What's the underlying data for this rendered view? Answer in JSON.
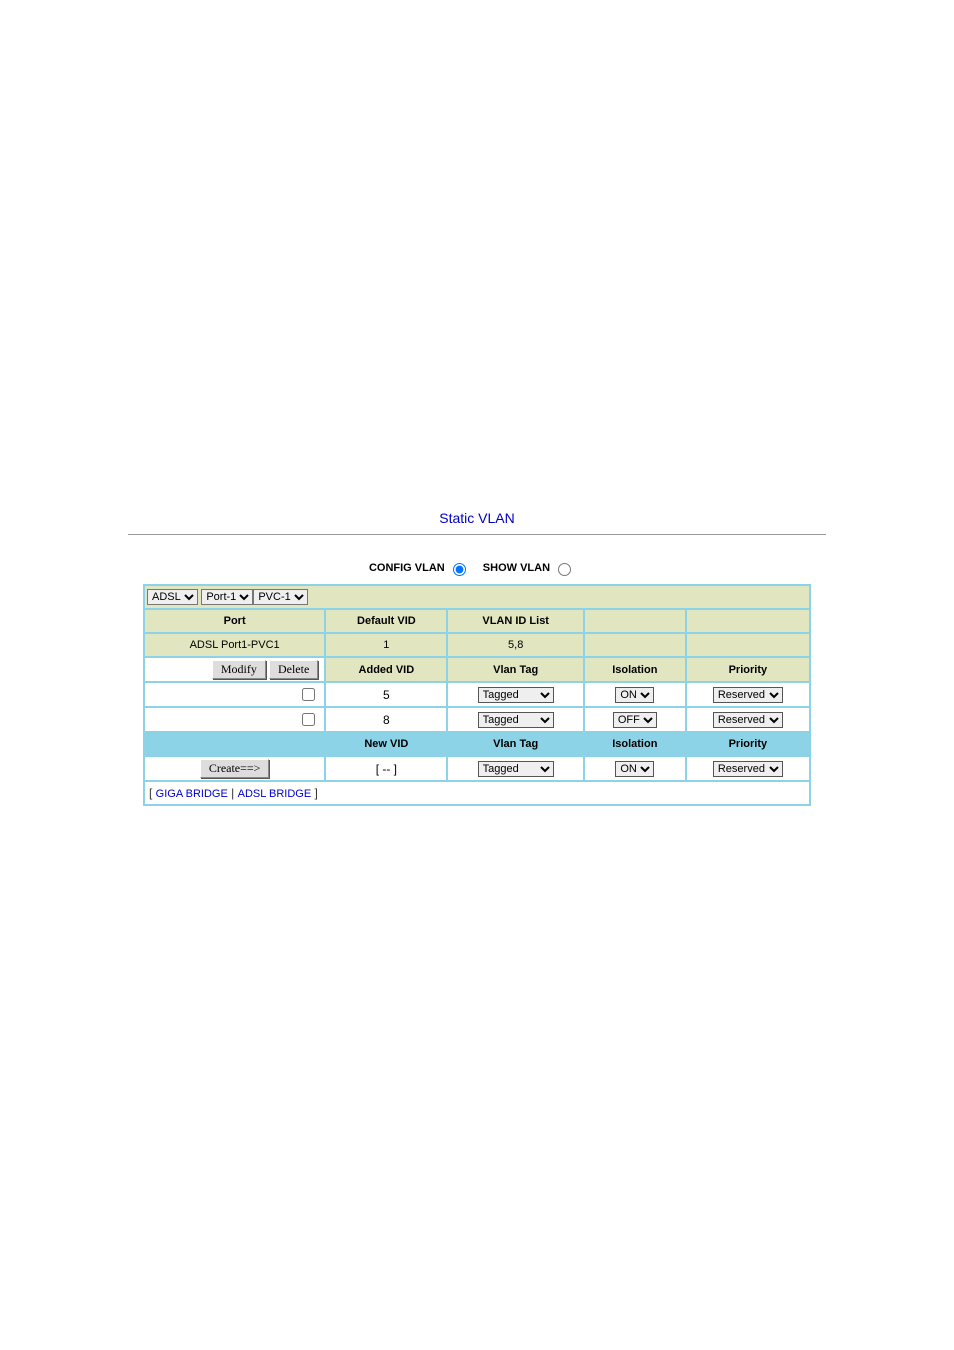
{
  "title": "Static VLAN",
  "radios": {
    "config_label": "CONFIG VLAN",
    "show_label": "SHOW VLAN"
  },
  "selectors": {
    "type": "ADSL",
    "port": "Port-1",
    "pvc": "PVC-1"
  },
  "headers1": {
    "port": "Port",
    "default_vid": "Default VID",
    "vlan_id_list": "VLAN ID List"
  },
  "port_row": {
    "name": "ADSL Port1-PVC1",
    "default_vid": "1",
    "vlan_list": "5,8"
  },
  "buttons": {
    "modify": "Modify",
    "delete": "Delete",
    "create": "Create==>"
  },
  "headers2": {
    "added_vid": "Added VID",
    "vlan_tag": "Vlan Tag",
    "isolation": "Isolation",
    "priority": "Priority"
  },
  "vid_rows": [
    {
      "vid": "5",
      "tag": "Tagged",
      "isolation": "ON",
      "priority": "Reserved"
    },
    {
      "vid": "8",
      "tag": "Tagged",
      "isolation": "OFF",
      "priority": "Reserved"
    }
  ],
  "headers3": {
    "new_vid": "New VID",
    "vlan_tag": "Vlan Tag",
    "isolation": "Isolation",
    "priority": "Priority"
  },
  "new_row": {
    "vid": "[   --   ]",
    "tag": "Tagged",
    "isolation": "ON",
    "priority": "Reserved"
  },
  "links": {
    "giga": "GIGA BRIDGE",
    "adsl": "ADSL BRIDGE"
  }
}
